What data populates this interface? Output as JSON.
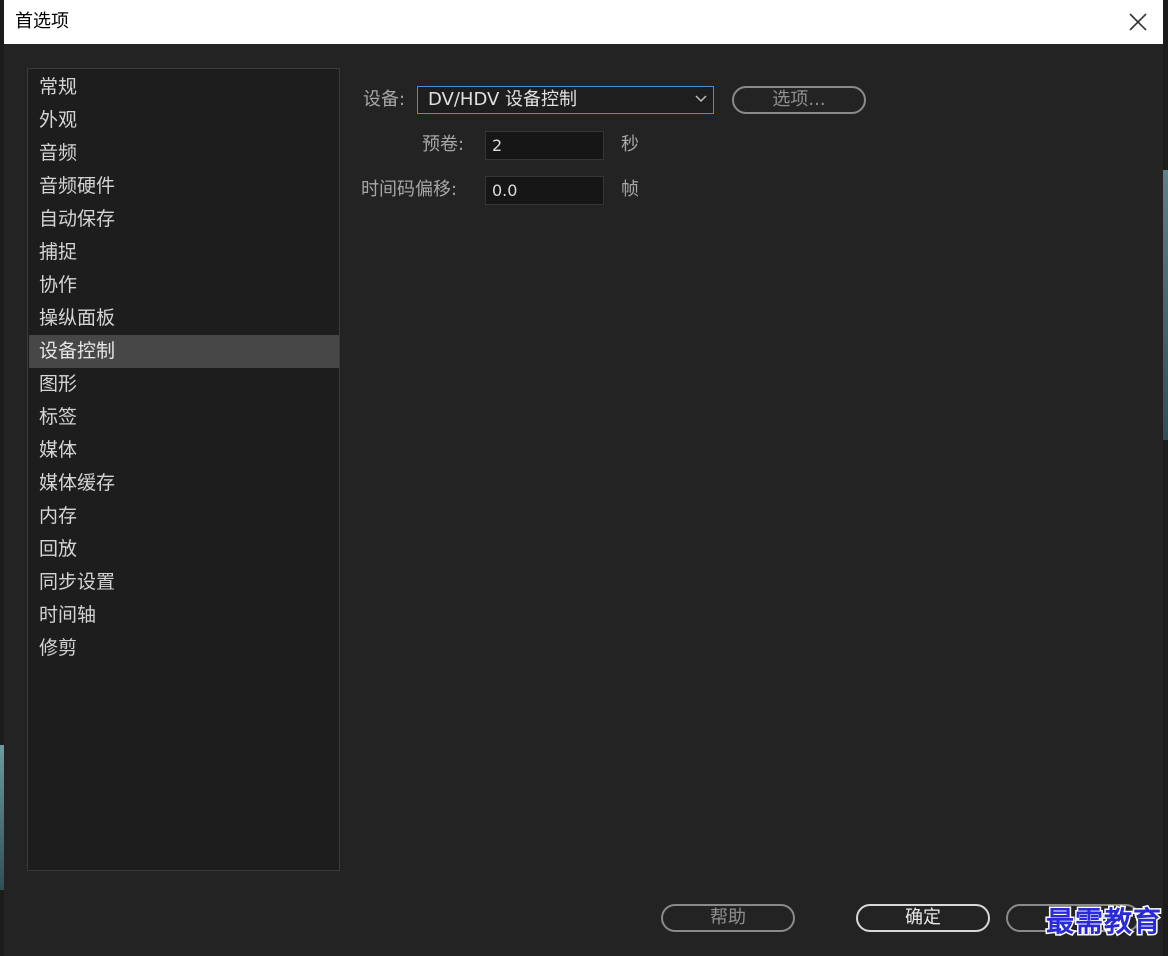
{
  "window": {
    "title": "首选项"
  },
  "sidebar": {
    "items": [
      {
        "label": "常规",
        "selected": false
      },
      {
        "label": "外观",
        "selected": false
      },
      {
        "label": "音频",
        "selected": false
      },
      {
        "label": "音频硬件",
        "selected": false
      },
      {
        "label": "自动保存",
        "selected": false
      },
      {
        "label": "捕捉",
        "selected": false
      },
      {
        "label": "协作",
        "selected": false
      },
      {
        "label": "操纵面板",
        "selected": false
      },
      {
        "label": "设备控制",
        "selected": true
      },
      {
        "label": "图形",
        "selected": false
      },
      {
        "label": "标签",
        "selected": false
      },
      {
        "label": "媒体",
        "selected": false
      },
      {
        "label": "媒体缓存",
        "selected": false
      },
      {
        "label": "内存",
        "selected": false
      },
      {
        "label": "回放",
        "selected": false
      },
      {
        "label": "同步设置",
        "selected": false
      },
      {
        "label": "时间轴",
        "selected": false
      },
      {
        "label": "修剪",
        "selected": false
      }
    ]
  },
  "device_control": {
    "device_label": "设备:",
    "device_value": "DV/HDV 设备控制",
    "options_button": "选项...",
    "preroll_label": "预卷:",
    "preroll_value": "2",
    "preroll_unit": "秒",
    "timecode_offset_label": "时间码偏移:",
    "timecode_offset_value": "0.0",
    "timecode_offset_unit": "帧"
  },
  "footer": {
    "help_button": "帮助",
    "ok_button": "确定"
  },
  "watermark": {
    "text": "最需教育"
  },
  "colors": {
    "background": "#232323",
    "selection": "#474747",
    "focus_border": "#4a8ad8",
    "watermark": "#2a2ad8"
  },
  "icons": {
    "close": "close-icon",
    "dropdown": "chevron-down-icon"
  }
}
